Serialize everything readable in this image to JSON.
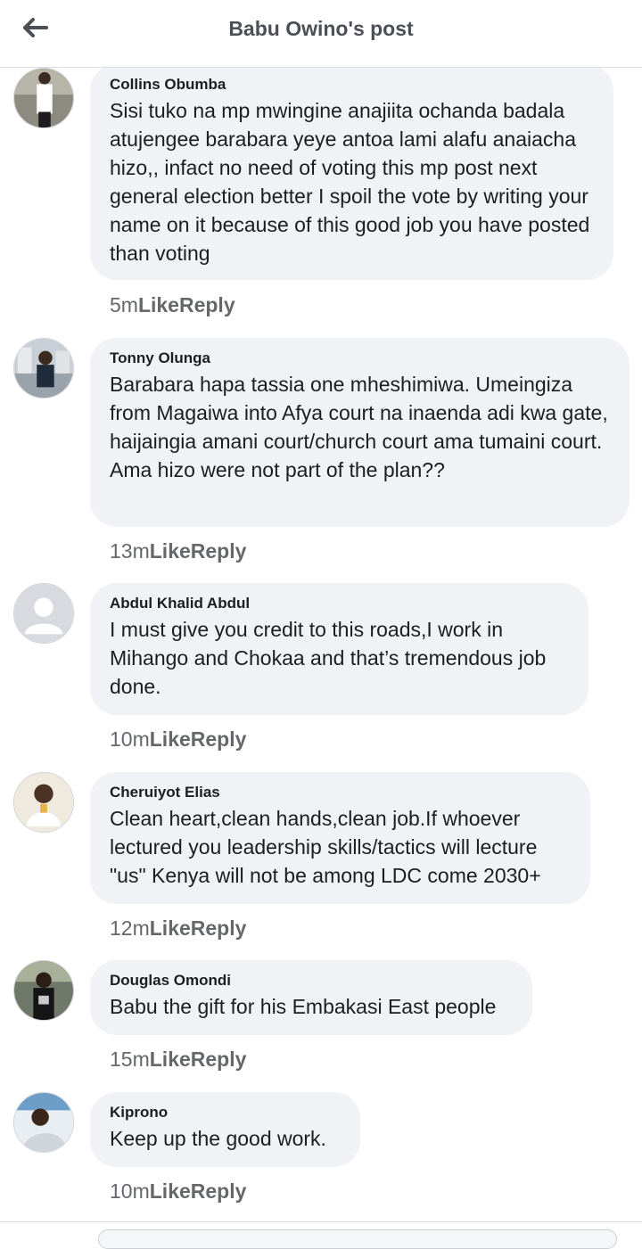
{
  "header": {
    "title": "Babu Owino's post",
    "back_icon": "arrow-left-icon"
  },
  "colors": {
    "bubble": "#f0f2f5",
    "meta": "#65676b",
    "text": "#1c1e21",
    "header_text": "#4b4f56"
  },
  "comments": [
    {
      "author": "Collins Obumba",
      "text": "Sisi tuko na mp mwingine anajiita ochanda badala atujengee barabara yeye antoa lami alafu anaiacha hizo,, infact no need of voting this mp post next general election better I spoil the vote by writing your name on it because of this good job you have posted than voting",
      "time": "5m",
      "like": "Like",
      "reply": "Reply"
    },
    {
      "author": "Tonny Olunga",
      "text": "Barabara hapa tassia one mheshimiwa. Umeingiza from Magaiwa into Afya court na inaenda adi kwa gate, haijaingia amani court/church court ama tumaini court. Ama hizo were not part of the plan??",
      "time": "13m",
      "like": "Like",
      "reply": "Reply"
    },
    {
      "author": "Abdul Khalid Abdul",
      "text": "I must give you credit to this roads,I work in Mihango and Chokaa and that’s tremendous job done.",
      "time": "10m",
      "like": "Like",
      "reply": "Reply"
    },
    {
      "author": "Cheruiyot Elias",
      "text": "Clean heart,clean hands,clean job.If  whoever lectured you leadership skills/tactics will lecture \"us\" Kenya will not be among LDC come 2030+",
      "time": "12m",
      "like": "Like",
      "reply": "Reply"
    },
    {
      "author": "Douglas Omondi",
      "text": "Babu the gift for his Embakasi East people",
      "time": "15m",
      "like": "Like",
      "reply": "Reply"
    },
    {
      "author": "Kiprono",
      "text": "Keep up the good work.",
      "time": "10m",
      "like": "Like",
      "reply": "Reply"
    }
  ]
}
